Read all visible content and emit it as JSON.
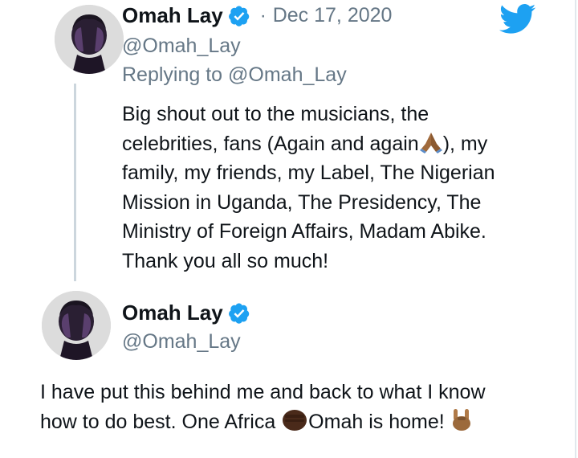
{
  "colors": {
    "brand": "#1da1f2",
    "secondary_text": "#657786",
    "primary_text": "#0f1419",
    "thread_line": "#ccd6dd"
  },
  "icons": {
    "logo": "twitter-bird-icon",
    "verified": "verified-badge-icon",
    "avatar": "avatar-photo"
  },
  "tweet1": {
    "name": "Omah Lay",
    "separator": "·",
    "date": "Dec 17, 2020",
    "handle": "@Omah_Lay",
    "replying_to": "Replying to @Omah_Lay",
    "lines": [
      "Big shout out to the musicians, the",
      "celebrities, fans (Again and again",
      "), my",
      "family, my friends, my Label, The Nigerian",
      "Mission in Uganda, The Presidency, The",
      "Ministry of Foreign Affairs, Madam Abike.",
      "Thank you all so much!"
    ]
  },
  "tweet2": {
    "name": "Omah Lay",
    "handle": "@Omah_Lay",
    "lines": [
      "I have put this behind me and back to what I know",
      "how to do best. One Africa ",
      "Omah is home! "
    ]
  }
}
